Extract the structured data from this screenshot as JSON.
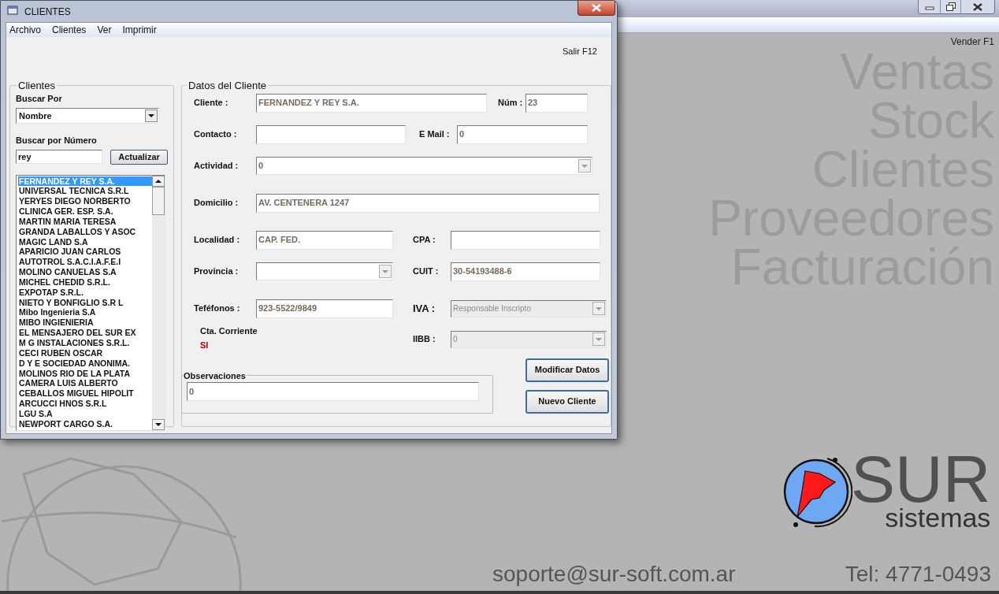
{
  "main_window": {
    "shortcut": "Vender F1",
    "modules": [
      "Ventas",
      "Stock",
      "Clientes",
      "Proveedores",
      "Facturación"
    ],
    "logo": {
      "brand": "SUR",
      "tagline": "sistemas"
    },
    "email": "soporte@sur-soft.com.ar",
    "phone": "Tel: 4771-0493"
  },
  "dialog": {
    "title": "CLIENTES",
    "menu": [
      "Archivo",
      "Clientes",
      "Ver",
      "Imprimir"
    ],
    "exit_shortcut": "Salir F12",
    "search_panel": {
      "title": "Clientes",
      "search_by_label": "Buscar Por",
      "search_by": "Nombre",
      "number_label": "Buscar por Número",
      "query": "rey",
      "refresh_button": "Actualizar",
      "results": [
        {
          "name": "FERNANDEZ Y REY S.A.",
          "selected": true
        },
        {
          "name": "UNIVERSAL TECNICA S.R.L",
          "selected": false
        },
        {
          "name": "YERYES DIEGO NORBERTO",
          "selected": false
        },
        {
          "name": "CLINICA GER. ESP. S.A.",
          "selected": false
        },
        {
          "name": "MARTIN MARIA TERESA",
          "selected": false
        },
        {
          "name": "GRANDA LABALLOS Y ASOC",
          "selected": false
        },
        {
          "name": "MAGIC LAND S.A",
          "selected": false
        },
        {
          "name": "APARICIO JUAN CARLOS",
          "selected": false
        },
        {
          "name": "AUTOTROL S.A.C.I.A.F.E.I",
          "selected": false
        },
        {
          "name": "MOLINO CANUELAS S.A",
          "selected": false
        },
        {
          "name": "MICHEL CHEDID S.R.L.",
          "selected": false
        },
        {
          "name": "EXPOTAP S.R.L.",
          "selected": false
        },
        {
          "name": "NIETO Y BONFIGLIO S.R L",
          "selected": false
        },
        {
          "name": "Mibo Ingenieria S.A",
          "selected": false
        },
        {
          "name": "MIBO INGIENIERIA",
          "selected": false
        },
        {
          "name": "EL MENSAJERO DEL SUR EX",
          "selected": false
        },
        {
          "name": "M G INSTALACIONES S.R.L.",
          "selected": false
        },
        {
          "name": "CECI RUBEN OSCAR",
          "selected": false
        },
        {
          "name": "D Y E SOCIEDAD ANONIMA.",
          "selected": false
        },
        {
          "name": "MOLINOS RIO DE LA PLATA",
          "selected": false
        },
        {
          "name": "CAMERA LUIS ALBERTO",
          "selected": false
        },
        {
          "name": "CEBALLOS MIGUEL HIPOLIT",
          "selected": false
        },
        {
          "name": "ARCUCCI HNOS S.R.L",
          "selected": false
        },
        {
          "name": "LGU S.A",
          "selected": false
        },
        {
          "name": "NEWPORT CARGO S.A.",
          "selected": false
        }
      ]
    },
    "details": {
      "title": "Datos del Cliente",
      "fields": [
        {
          "label": "Cliente :",
          "value": "FERNANDEZ Y REY S.A.",
          "kind": "text",
          "disabled": false
        },
        {
          "label": "Núm :",
          "value": "23",
          "kind": "text",
          "disabled": false
        },
        {
          "label": "Contacto :",
          "kind": "text",
          "disabled": false
        },
        {
          "label": "E Mail :",
          "value": "0",
          "kind": "text",
          "disabled": false
        },
        {
          "label": "Actividad :",
          "value": "0",
          "kind": "select",
          "disabled": false
        },
        {
          "label": "Domicilio :",
          "value": "AV. CENTENERA 1247",
          "kind": "text",
          "disabled": false
        },
        {
          "label": "Localidad :",
          "value": "CAP. FED.",
          "kind": "text",
          "disabled": false
        },
        {
          "label": "CPA :",
          "kind": "text",
          "disabled": false
        },
        {
          "label": "Provincia :",
          "kind": "select",
          "disabled": false
        },
        {
          "label": "CUIT :",
          "value": "30-54193488-6",
          "kind": "text",
          "disabled": false
        },
        {
          "label": "Teféfonos :",
          "value": "923-5522/9849",
          "kind": "text",
          "disabled": false
        },
        {
          "label": "IVA :",
          "value": "Responsable Inscripto",
          "kind": "select",
          "disabled": true
        },
        {
          "label": "IIBB :",
          "value": "0",
          "kind": "select",
          "disabled": true
        }
      ],
      "account": {
        "label": "Cta. Corriente",
        "value": "SI"
      },
      "notes": {
        "title": "Observaciones",
        "value": "0"
      },
      "buttons": [
        "Modificar Datos",
        "Nuevo Cliente"
      ]
    }
  }
}
